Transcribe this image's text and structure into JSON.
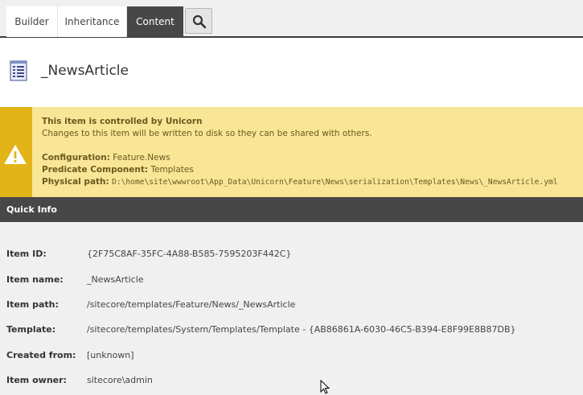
{
  "tabs": [
    {
      "label": "Builder",
      "active": false
    },
    {
      "label": "Inheritance",
      "active": false
    },
    {
      "label": "Content",
      "active": true
    }
  ],
  "header": {
    "item_title": "_NewsArticle",
    "item_icon": "template-document-icon"
  },
  "warning": {
    "title": "This item is controlled by Unicorn",
    "message": "Changes to this item will be written to disk so they can be shared with others.",
    "configuration_label": "Configuration:",
    "configuration_value": "Feature.News",
    "predicate_label": "Predicate Component:",
    "predicate_value": "Templates",
    "path_label": "Physical path:",
    "path_value": "D:\\home\\site\\wwwroot\\App_Data\\Unicorn\\Feature\\News\\serialization\\Templates\\News\\_NewsArticle.yml"
  },
  "quick_info": {
    "title": "Quick Info",
    "rows": [
      {
        "label": "Item ID:",
        "value": "{2F75C8AF-35FC-4A88-B585-7595203F442C}"
      },
      {
        "label": "Item name:",
        "value": "_NewsArticle"
      },
      {
        "label": "Item path:",
        "value": "/sitecore/templates/Feature/News/_NewsArticle"
      },
      {
        "label": "Template:",
        "value": "/sitecore/templates/System/Templates/Template - {AB86861A-6030-46C5-B394-E8F99E8B87DB}"
      },
      {
        "label": "Created from:",
        "value": "[unknown]"
      },
      {
        "label": "Item owner:",
        "value": "sitecore\\admin"
      }
    ]
  },
  "colors": {
    "tab_active": "#474747",
    "warning_bg": "#f9e596",
    "warning_side": "#e3b417",
    "section_header": "#474747"
  }
}
